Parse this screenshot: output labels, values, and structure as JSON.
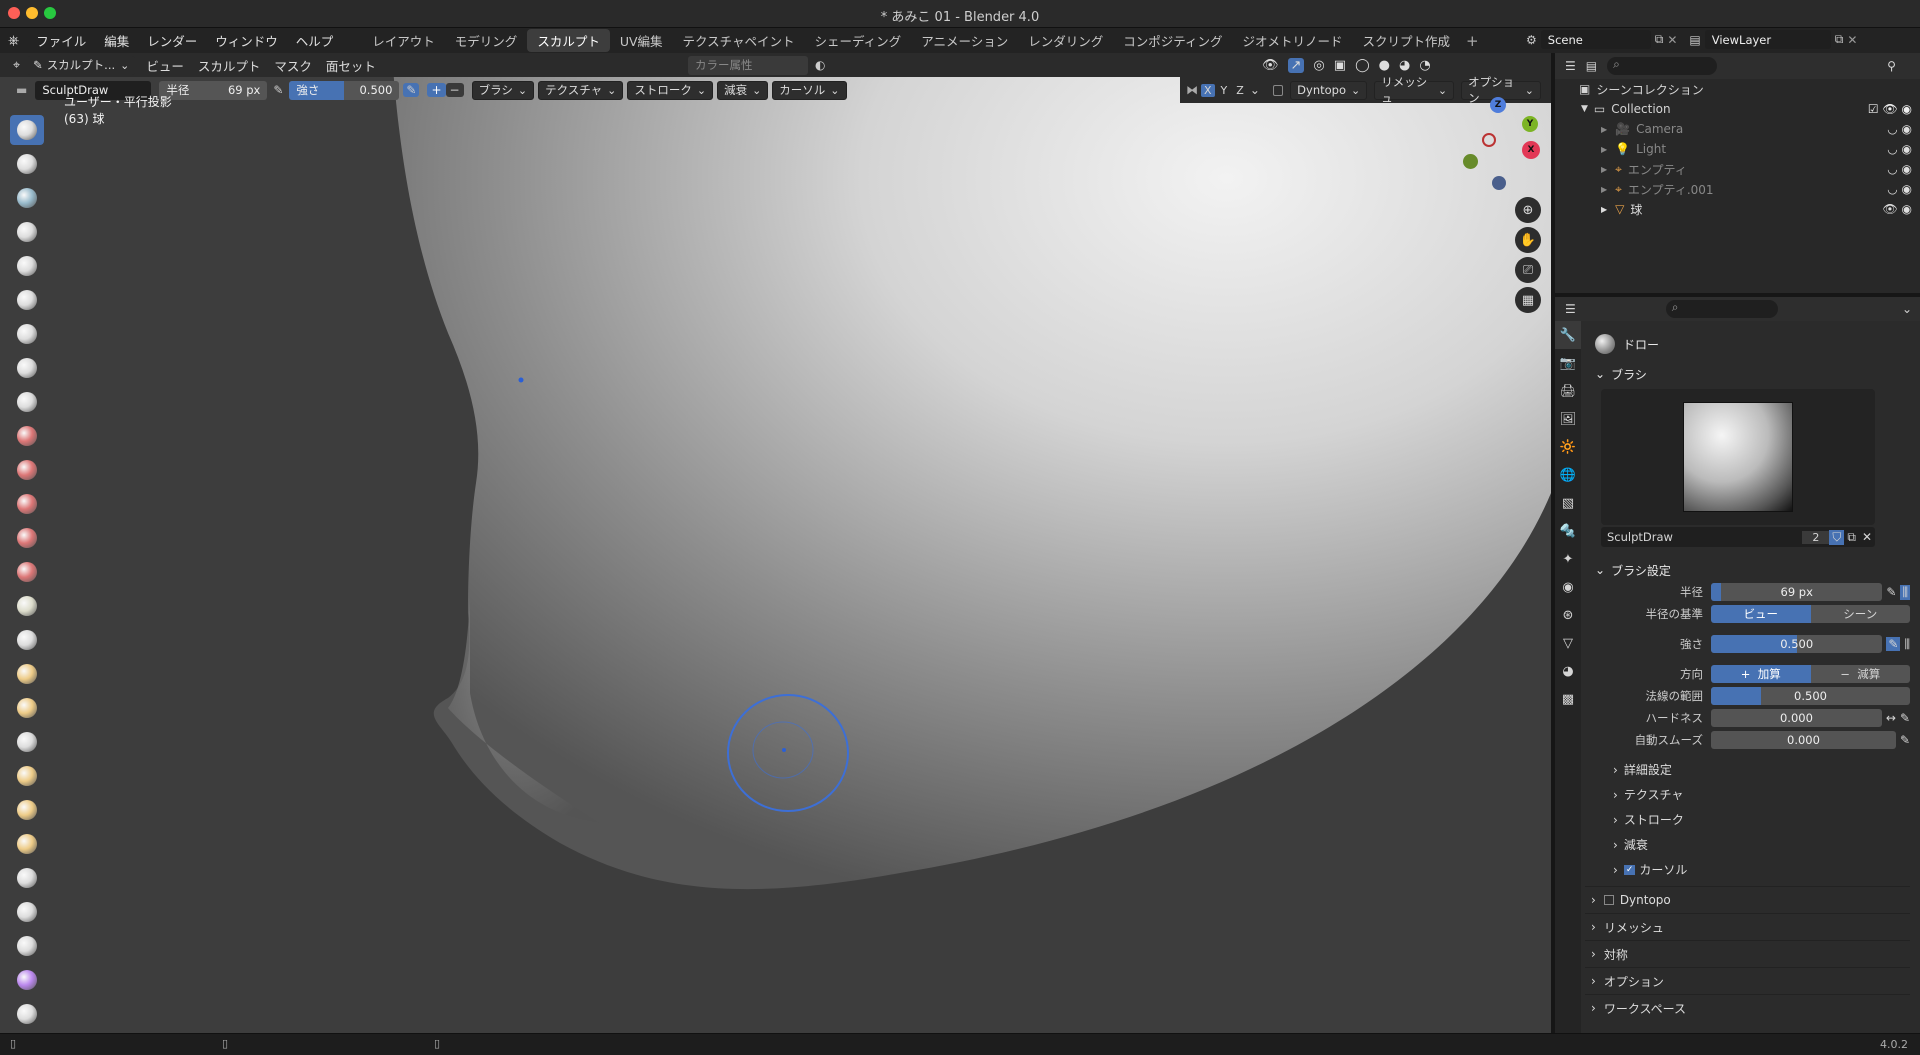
{
  "window": {
    "title": "* あみこ 01 - Blender 4.0"
  },
  "menu": [
    "ファイル",
    "編集",
    "レンダー",
    "ウィンドウ",
    "ヘルプ"
  ],
  "workspaces": [
    {
      "label": "レイアウト",
      "active": false
    },
    {
      "label": "モデリング",
      "active": false
    },
    {
      "label": "スカルプト",
      "active": true
    },
    {
      "label": "UV編集",
      "active": false
    },
    {
      "label": "テクスチャペイント",
      "active": false
    },
    {
      "label": "シェーディング",
      "active": false
    },
    {
      "label": "アニメーション",
      "active": false
    },
    {
      "label": "レンダリング",
      "active": false
    },
    {
      "label": "コンポジティング",
      "active": false
    },
    {
      "label": "ジオメトリノード",
      "active": false
    },
    {
      "label": "スクリプト作成",
      "active": false
    }
  ],
  "scene": {
    "name": "Scene"
  },
  "view_layer": {
    "name": "ViewLayer"
  },
  "viewport_header": {
    "mode": "スカルプト...",
    "menus": [
      "ビュー",
      "スカルプト",
      "マスク",
      "面セット"
    ],
    "color_attr_placeholder": "カラー属性"
  },
  "tool_settings": {
    "brush_name": "SculptDraw",
    "radius_label": "半径",
    "radius_value": "69 px",
    "strength_label": "強さ",
    "strength_value": "0.500",
    "strength_fraction": 0.5,
    "dropdowns": [
      "ブラシ",
      "テクスチャ",
      "ストローク",
      "減衰",
      "カーソル"
    ],
    "axes": [
      "X",
      "Y",
      "Z"
    ],
    "right_dropdowns": [
      "Dyntopo",
      "リメッシュ",
      "オプション"
    ]
  },
  "overlay": {
    "view_name": "ユーザー・平行投影",
    "object_info": "(63) 球"
  },
  "gizmo": {
    "z": "Z",
    "y": "Y",
    "x": "X"
  },
  "outliner": {
    "root": "シーンコレクション",
    "collection": "Collection",
    "items": [
      {
        "name": "Camera",
        "icon": "camera-icon",
        "dim": true
      },
      {
        "name": "Light",
        "icon": "light-icon",
        "dim": true
      },
      {
        "name": "エンプティ",
        "icon": "empty-icon",
        "dim": true
      },
      {
        "name": "エンプティ.001",
        "icon": "empty-icon",
        "dim": true
      },
      {
        "name": "球",
        "icon": "mesh-icon",
        "dim": false
      }
    ]
  },
  "properties": {
    "tool_title": "ドロー",
    "brush_panel": "ブラシ",
    "brush_datablock": "SculptDraw",
    "brush_users": "2",
    "brush_settings": "ブラシ設定",
    "rows": {
      "radius": {
        "label": "半径",
        "value": "69 px",
        "fraction": 0.06
      },
      "radius_unit": {
        "label": "半径の基準",
        "opt_a": "ビュー",
        "opt_b": "シーン"
      },
      "strength": {
        "label": "強さ",
        "value": "0.500",
        "fraction": 0.5
      },
      "direction": {
        "label": "方向",
        "opt_a": "加算",
        "opt_b": "減算"
      },
      "normal_radius": {
        "label": "法線の範囲",
        "value": "0.500",
        "fraction": 0.25
      },
      "hardness": {
        "label": "ハードネス",
        "value": "0.000",
        "fraction": 0
      },
      "auto_smooth": {
        "label": "自動スムーズ",
        "value": "0.000",
        "fraction": 0
      }
    },
    "subpanels": [
      "詳細設定",
      "テクスチャ",
      "ストローク",
      "減衰",
      "カーソル"
    ],
    "collapsed_panels": [
      "Dyntopo",
      "リメッシュ",
      "対称",
      "オプション",
      "ワークスペース"
    ]
  },
  "status": {
    "version": "4.0.2"
  }
}
